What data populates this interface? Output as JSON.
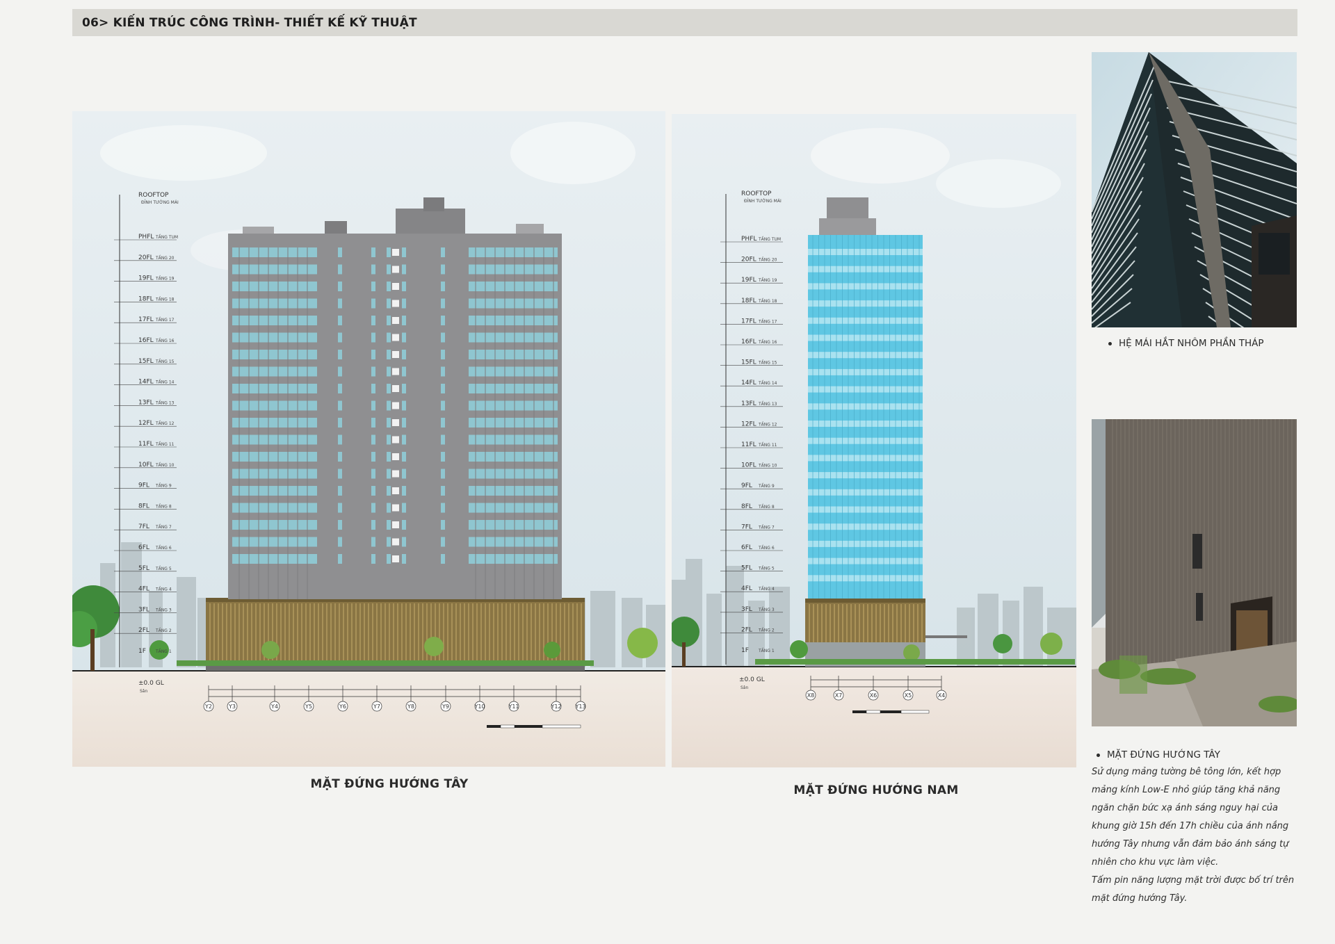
{
  "header": {
    "title": "06> KIẾN TRÚC CÔNG TRÌNH- THIẾT KẾ KỸ THUẬT"
  },
  "west_elevation": {
    "caption": "MẶT ĐỨNG HƯỚNG TÂY",
    "rooftop_label": "ROOFTOP",
    "rooftop_sub": "ĐỈNH TƯỜNG MÁI",
    "levels": [
      {
        "code": "PHFL",
        "name": "TẦNG TUM"
      },
      {
        "code": "20FL",
        "name": "TẦNG 20"
      },
      {
        "code": "19FL",
        "name": "TẦNG 19"
      },
      {
        "code": "18FL",
        "name": "TẦNG 18"
      },
      {
        "code": "17FL",
        "name": "TẦNG 17"
      },
      {
        "code": "16FL",
        "name": "TẦNG 16"
      },
      {
        "code": "15FL",
        "name": "TẦNG 15"
      },
      {
        "code": "14FL",
        "name": "TẦNG 14"
      },
      {
        "code": "13FL",
        "name": "TẦNG 13"
      },
      {
        "code": "12FL",
        "name": "TẦNG 12"
      },
      {
        "code": "11FL",
        "name": "TẦNG 11"
      },
      {
        "code": "10FL",
        "name": "TẦNG 10"
      },
      {
        "code": "9FL",
        "name": "TẦNG 9"
      },
      {
        "code": "8FL",
        "name": "TẦNG 8"
      },
      {
        "code": "7FL",
        "name": "TẦNG 7"
      },
      {
        "code": "6FL",
        "name": "TẦNG 6"
      },
      {
        "code": "5FL",
        "name": "TẦNG 5"
      },
      {
        "code": "4FL",
        "name": "TẦNG 4"
      },
      {
        "code": "3FL",
        "name": "TẦNG 3"
      },
      {
        "code": "2FL",
        "name": "TẦNG 2"
      }
    ],
    "ground_label": "1F",
    "ground_sub": "TẦNG 1",
    "gl_label": "±0.0 GL",
    "gl_sub": "Sân",
    "grid_axes": [
      "Y2",
      "Y3",
      "Y4",
      "Y5",
      "Y6",
      "Y7",
      "Y8",
      "Y9",
      "Y10",
      "Y11",
      "Y12",
      "Y13"
    ]
  },
  "south_elevation": {
    "caption": "MẶT ĐỨNG HƯỚNG NAM",
    "rooftop_label": "ROOFTOP",
    "rooftop_sub": "ĐỈNH TƯỜNG MÁI",
    "levels": [
      {
        "code": "PHFL",
        "name": "TẦNG TUM"
      },
      {
        "code": "20FL",
        "name": "TẦNG 20"
      },
      {
        "code": "19FL",
        "name": "TẦNG 19"
      },
      {
        "code": "18FL",
        "name": "TẦNG 18"
      },
      {
        "code": "17FL",
        "name": "TẦNG 17"
      },
      {
        "code": "16FL",
        "name": "TẦNG 16"
      },
      {
        "code": "15FL",
        "name": "TẦNG 15"
      },
      {
        "code": "14FL",
        "name": "TẦNG 14"
      },
      {
        "code": "13FL",
        "name": "TẦNG 13"
      },
      {
        "code": "12FL",
        "name": "TẦNG 12"
      },
      {
        "code": "11FL",
        "name": "TẦNG 11"
      },
      {
        "code": "10FL",
        "name": "TẦNG 10"
      },
      {
        "code": "9FL",
        "name": "TẦNG 9"
      },
      {
        "code": "8FL",
        "name": "TẦNG 8"
      },
      {
        "code": "7FL",
        "name": "TẦNG 7"
      },
      {
        "code": "6FL",
        "name": "TẦNG 6"
      },
      {
        "code": "5FL",
        "name": "TẦNG 5"
      },
      {
        "code": "4FL",
        "name": "TẦNG 4"
      },
      {
        "code": "3FL",
        "name": "TẦNG 3"
      },
      {
        "code": "2FL",
        "name": "TẦNG 2"
      }
    ],
    "ground_label": "1F",
    "ground_sub": "TẦNG 1",
    "gl_label": "±0.0 GL",
    "gl_sub": "Sân",
    "grid_axes": [
      "X8",
      "X7",
      "X6",
      "X5",
      "X4"
    ]
  },
  "photo_top": {
    "bullet": "HỆ MÁI HẮT NHÔM PHẦN THÁP"
  },
  "photo_bottom": {
    "bullet": "MẶT ĐỨNG HƯỚNG TÂY"
  },
  "description": {
    "lines": [
      "Sử dụng mảng tường bê tông lớn, kết hợp",
      "mảng kính Low-E nhỏ giúp tăng khả năng",
      "ngăn chặn bức xạ ánh sáng nguy hại của",
      "khung giờ 15h đến 17h chiều của ánh nắng",
      "hướng Tây nhưng vẫn đảm bảo ánh sáng tự",
      "nhiên cho khu vực làm việc.",
      "Tấm pin năng lượng mặt trời được bố trí trên",
      "mặt đứng hướng Tây."
    ]
  },
  "colors": {
    "header_bg": "#d9d8d3",
    "concrete": "#8f8f91",
    "glass_west": "#8fc6d0",
    "glass_south": "#5fc7e3",
    "podium": "#8a7544",
    "sky": "#dfe8ec",
    "ground": "#efe6de"
  }
}
